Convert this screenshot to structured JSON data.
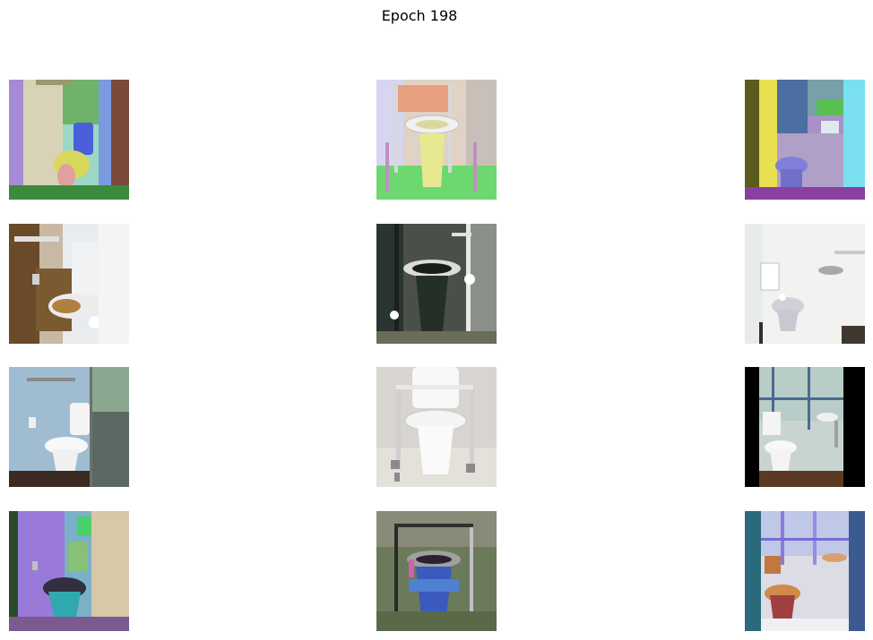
{
  "figure": {
    "title": "Epoch 198"
  }
}
